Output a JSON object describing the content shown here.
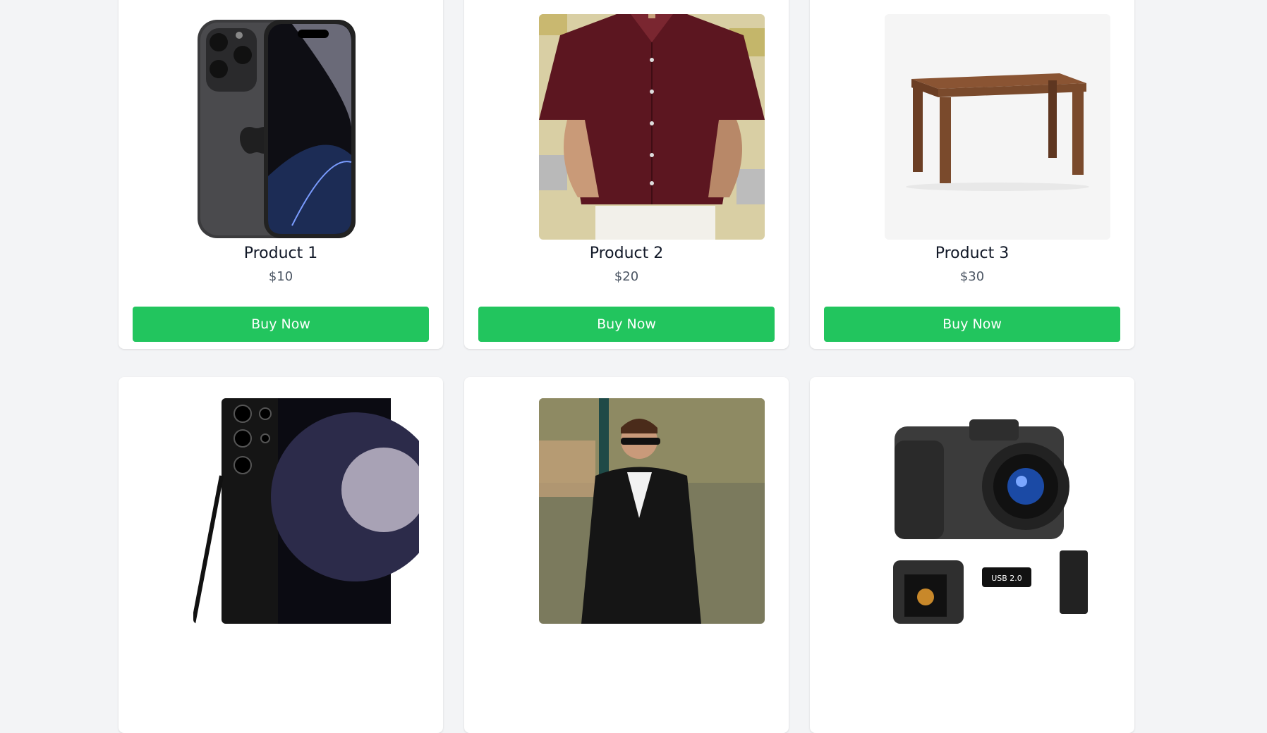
{
  "products": [
    {
      "title": "Product 1",
      "price": "$10",
      "button": "Buy Now",
      "image": "iphone"
    },
    {
      "title": "Product 2",
      "price": "$20",
      "button": "Buy Now",
      "image": "maroon-shirt"
    },
    {
      "title": "Product 3",
      "price": "$30",
      "button": "Buy Now",
      "image": "wooden-table"
    },
    {
      "title": "",
      "price": "",
      "button": "",
      "image": "samsung-phone"
    },
    {
      "title": "",
      "price": "",
      "button": "",
      "image": "leather-jacket-man"
    },
    {
      "title": "",
      "price": "",
      "button": "",
      "image": "dslr-camera"
    }
  ],
  "colors": {
    "background": "#f3f4f6",
    "card": "#ffffff",
    "button": "#22c55e",
    "button_text": "#ffffff",
    "title": "#111827",
    "price": "#4b5563"
  },
  "camera_card": {
    "usb_label": "USB 2.0"
  }
}
